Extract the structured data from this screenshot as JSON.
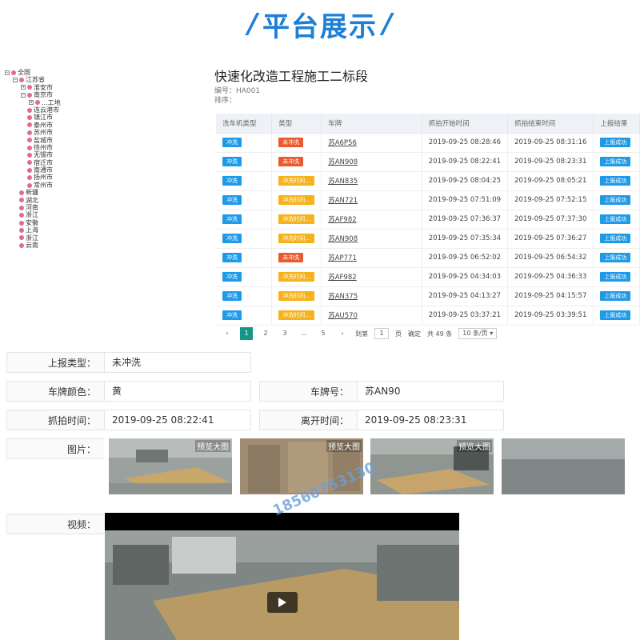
{
  "banner": {
    "title": "平台展示"
  },
  "tree": {
    "items": [
      {
        "label": "全国",
        "depth": 0,
        "toggle": "⊟"
      },
      {
        "label": "江苏省",
        "depth": 1,
        "toggle": "⊟"
      },
      {
        "label": "淮安市",
        "depth": 2,
        "toggle": "⊞"
      },
      {
        "label": "南京市",
        "depth": 2,
        "toggle": "⊟"
      },
      {
        "label": "...工地",
        "depth": 3,
        "toggle": "⊞"
      },
      {
        "label": "连云港市",
        "depth": 2,
        "toggle": ""
      },
      {
        "label": "镇江市",
        "depth": 2,
        "toggle": ""
      },
      {
        "label": "泰州市",
        "depth": 2,
        "toggle": ""
      },
      {
        "label": "苏州市",
        "depth": 2,
        "toggle": ""
      },
      {
        "label": "盐城市",
        "depth": 2,
        "toggle": ""
      },
      {
        "label": "徐州市",
        "depth": 2,
        "toggle": ""
      },
      {
        "label": "无锡市",
        "depth": 2,
        "toggle": ""
      },
      {
        "label": "宿迁市",
        "depth": 2,
        "toggle": ""
      },
      {
        "label": "南通市",
        "depth": 2,
        "toggle": ""
      },
      {
        "label": "扬州市",
        "depth": 2,
        "toggle": ""
      },
      {
        "label": "常州市",
        "depth": 2,
        "toggle": ""
      },
      {
        "label": "新疆",
        "depth": 1,
        "toggle": ""
      },
      {
        "label": "湖北",
        "depth": 1,
        "toggle": ""
      },
      {
        "label": "河南",
        "depth": 1,
        "toggle": ""
      },
      {
        "label": "浙江",
        "depth": 1,
        "toggle": ""
      },
      {
        "label": "安徽",
        "depth": 1,
        "toggle": ""
      },
      {
        "label": "上海",
        "depth": 1,
        "toggle": ""
      },
      {
        "label": "浙江",
        "depth": 1,
        "toggle": ""
      },
      {
        "label": "云南",
        "depth": 1,
        "toggle": ""
      }
    ]
  },
  "main": {
    "title": "快速化改造工程施工二标段",
    "code": "编号：HA001",
    "sort": "排序："
  },
  "table": {
    "headers": [
      "洗车机类型",
      "类型",
      "车牌",
      "抓拍开始时间",
      "抓拍结束时间",
      "上报结果"
    ],
    "rows": [
      {
        "machine": "冲洗",
        "type": "未冲洗",
        "type_color": "red",
        "plate": "苏A6P56",
        "start": "2019-09-25 08:28:46",
        "end": "2019-09-25 08:31:16",
        "result": "上报成功"
      },
      {
        "machine": "冲洗",
        "type": "未冲洗",
        "type_color": "red",
        "plate": "苏AN908",
        "start": "2019-09-25 08:22:41",
        "end": "2019-09-25 08:23:31",
        "result": "上报成功"
      },
      {
        "machine": "冲洗",
        "type": "冲洗时间...",
        "type_color": "yellow",
        "plate": "苏AN835",
        "start": "2019-09-25 08:04:25",
        "end": "2019-09-25 08:05:21",
        "result": "上报成功"
      },
      {
        "machine": "冲洗",
        "type": "冲洗时间...",
        "type_color": "yellow",
        "plate": "苏AN721",
        "start": "2019-09-25 07:51:09",
        "end": "2019-09-25 07:52:15",
        "result": "上报成功"
      },
      {
        "machine": "冲洗",
        "type": "冲洗时间...",
        "type_color": "yellow",
        "plate": "苏AF982",
        "start": "2019-09-25 07:36:37",
        "end": "2019-09-25 07:37:30",
        "result": "上报成功"
      },
      {
        "machine": "冲洗",
        "type": "冲洗时间...",
        "type_color": "yellow",
        "plate": "苏AN908",
        "start": "2019-09-25 07:35:34",
        "end": "2019-09-25 07:36:27",
        "result": "上报成功"
      },
      {
        "machine": "冲洗",
        "type": "未冲洗",
        "type_color": "red",
        "plate": "苏AP771",
        "start": "2019-09-25 06:52:02",
        "end": "2019-09-25 06:54:32",
        "result": "上报成功"
      },
      {
        "machine": "冲洗",
        "type": "冲洗时间...",
        "type_color": "yellow",
        "plate": "苏AF982",
        "start": "2019-09-25 04:34:03",
        "end": "2019-09-25 04:36:33",
        "result": "上报成功"
      },
      {
        "machine": "冲洗",
        "type": "冲洗时间...",
        "type_color": "yellow",
        "plate": "苏AN375",
        "start": "2019-09-25 04:13:27",
        "end": "2019-09-25 04:15:57",
        "result": "上报成功"
      },
      {
        "machine": "冲洗",
        "type": "冲洗时间...",
        "type_color": "yellow",
        "plate": "苏AU570",
        "start": "2019-09-25 03:37:21",
        "end": "2019-09-25 03:39:51",
        "result": "上报成功"
      }
    ]
  },
  "pager": {
    "prev": "‹",
    "pages": [
      "1",
      "2",
      "3",
      "...",
      "5"
    ],
    "next": "›",
    "goto_label": "到第",
    "goto_value": "1",
    "page_unit": "页",
    "confirm": "确定",
    "total": "共 49 条",
    "per_page": "10 条/页 ▾"
  },
  "detail": {
    "report_type_label": "上报类型：",
    "report_type_value": "未冲洗",
    "plate_color_label": "车牌颜色：",
    "plate_color_value": "黄",
    "plate_label": "车牌号：",
    "plate_value": "苏AN90",
    "capture_time_label": "抓拍时间：",
    "capture_time_value": "2019-09-25 08:22:41",
    "leave_time_label": "离开时间：",
    "leave_time_value": "2019-09-25 08:23:31",
    "images_label": "图片：",
    "preview_label": "预览大图",
    "video_label": "视频："
  },
  "watermark": "18560753130"
}
